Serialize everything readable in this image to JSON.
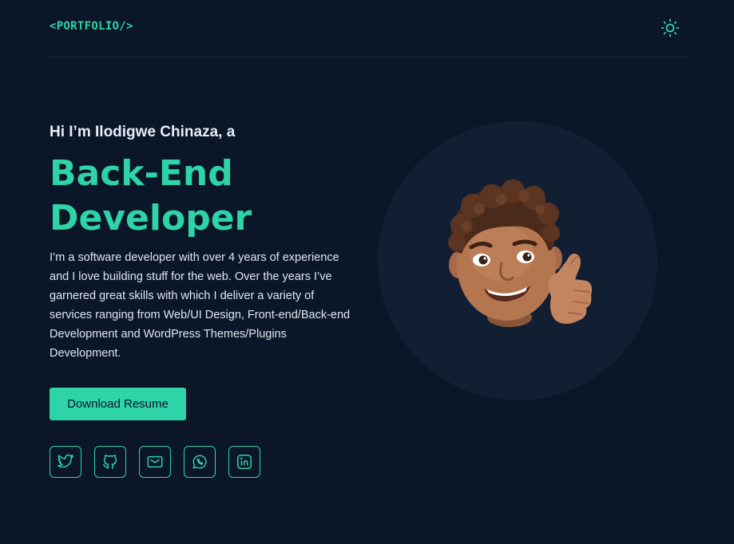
{
  "header": {
    "logo": "<PORTFOLIO/>",
    "theme_toggle_icon": "sun-icon"
  },
  "hero": {
    "greeting": "Hi I’m Ilodigwe Chinaza, a",
    "role_line1": "Back-End",
    "role_line2": "Developer",
    "bio": "I’m a software developer with over 4 years of experience and I love building stuff for the web. Over the years I’ve garnered great skills with which I deliver a variety of services ranging from Web/UI Design, Front-end/Back-end Development and WordPress Themes/Plugins Development.",
    "resume_label": "Download Resume",
    "avatar_icon": "memoji-thumbs-up-avatar"
  },
  "socials": [
    {
      "icon": "twitter-icon"
    },
    {
      "icon": "github-icon"
    },
    {
      "icon": "mail-icon"
    },
    {
      "icon": "whatsapp-icon"
    },
    {
      "icon": "linkedin-icon"
    }
  ],
  "colors": {
    "background": "#0b1628",
    "accent": "#2ed3a7",
    "avatar_circle": "#121f33"
  }
}
